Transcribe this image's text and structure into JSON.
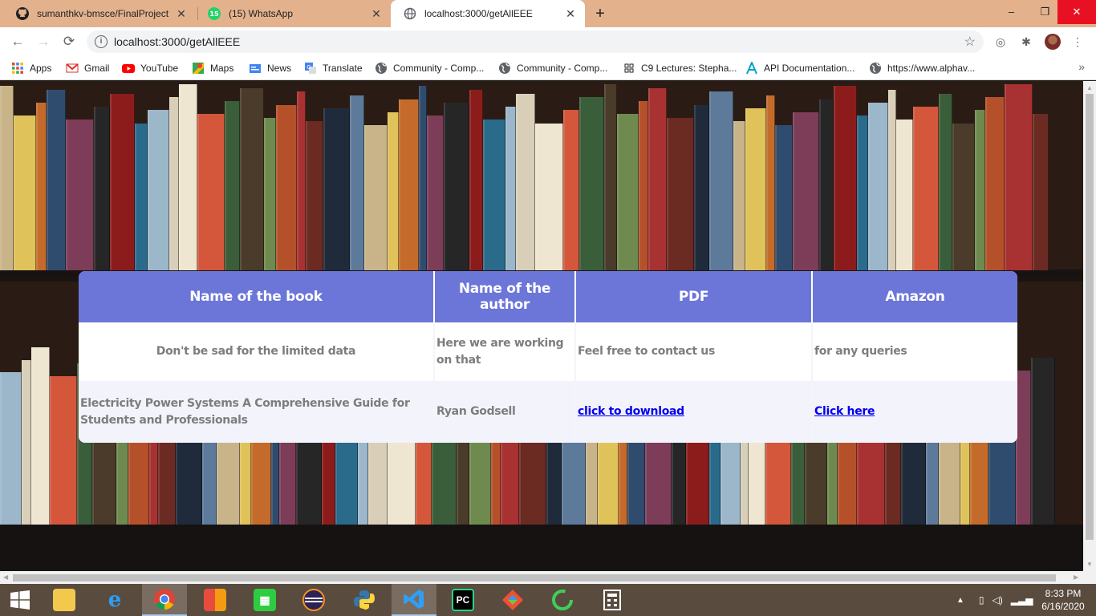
{
  "browser": {
    "tabs": [
      {
        "title": "sumanthkv-bmsce/FinalProject",
        "icon": "github-icon",
        "active": false
      },
      {
        "title": "(15) WhatsApp",
        "icon": "whatsapp-icon",
        "badge": "15",
        "active": false
      },
      {
        "title": "localhost:3000/getAllEEE",
        "icon": "globe-icon",
        "active": true
      }
    ],
    "new_tab_label": "+",
    "window_controls": {
      "minimize": "–",
      "maximize": "❐",
      "close": "✕"
    },
    "nav": {
      "back": "←",
      "forward": "→",
      "reload": "⟳"
    },
    "address": "localhost:3000/getAllEEE",
    "bookmarks": [
      {
        "label": "Apps",
        "icon": "apps-grid-icon"
      },
      {
        "label": "Gmail",
        "icon": "gmail-icon"
      },
      {
        "label": "YouTube",
        "icon": "youtube-icon"
      },
      {
        "label": "Maps",
        "icon": "maps-icon"
      },
      {
        "label": "News",
        "icon": "news-icon"
      },
      {
        "label": "Translate",
        "icon": "translate-icon"
      },
      {
        "label": "Community - Comp...",
        "icon": "globe-icon"
      },
      {
        "label": "Community - Comp...",
        "icon": "globe-icon"
      },
      {
        "label": "C9 Lectures: Stepha...",
        "icon": "channel9-icon"
      },
      {
        "label": "API Documentation...",
        "icon": "api-icon"
      },
      {
        "label": "https://www.alphav...",
        "icon": "globe-icon"
      }
    ],
    "bookmarks_overflow": "»"
  },
  "page": {
    "table": {
      "headers": [
        "Name of the book",
        "Name of the author",
        "PDF",
        "Amazon"
      ],
      "rows": [
        {
          "book": "Don't be sad for the limited data",
          "author": "Here we are working on that",
          "pdf": "Feel free to contact us",
          "amazon": "for any queries"
        },
        {
          "book": "Electricity Power Systems A Comprehensive Guide for Students and Professionals",
          "author": "Ryan Godsell",
          "pdf": "click to download",
          "amazon": "Click here"
        }
      ]
    },
    "colors": {
      "header_bg": "#6b76d8",
      "link": "#0000ee",
      "tab_strip": "#e3b28c"
    }
  },
  "taskbar": {
    "apps": [
      {
        "name": "start-button",
        "icon": "windows-logo-icon"
      },
      {
        "name": "file-explorer",
        "icon": "folder-icon"
      },
      {
        "name": "internet-explorer",
        "icon": "ie-icon"
      },
      {
        "name": "chrome",
        "icon": "chrome-icon",
        "active": true
      },
      {
        "name": "office",
        "icon": "office-icon"
      },
      {
        "name": "store",
        "icon": "store-icon"
      },
      {
        "name": "eclipse",
        "icon": "eclipse-icon"
      },
      {
        "name": "python",
        "icon": "python-icon"
      },
      {
        "name": "vscode",
        "icon": "vscode-icon",
        "active": true
      },
      {
        "name": "pycharm",
        "icon": "pycharm-icon",
        "label": "PC"
      },
      {
        "name": "git",
        "icon": "git-icon"
      },
      {
        "name": "app-green-ring",
        "icon": "ring-icon"
      },
      {
        "name": "calculator",
        "icon": "calculator-icon"
      }
    ],
    "clock": {
      "time": "8:33 PM",
      "date": "6/16/2020"
    }
  }
}
